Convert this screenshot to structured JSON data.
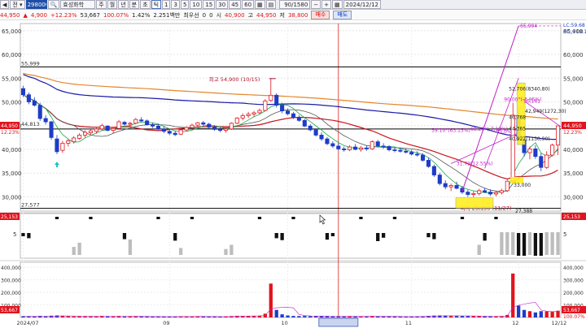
{
  "toolbar": {
    "code": "298000",
    "name": "효성화학",
    "tabs": [
      "주",
      "월",
      "년",
      "분",
      "초",
      "틱"
    ],
    "minutes": [
      "1",
      "3",
      "5",
      "10",
      "15",
      "30",
      "45",
      "60"
    ],
    "period": "90/1580",
    "date": "2024/12/12"
  },
  "info": {
    "price": "44,950",
    "change": "4,900",
    "change_pct": "+12.23%",
    "volume": "53,667",
    "vol_ratio": "100.07%",
    "turnover_ratio": "1.42%",
    "amount": "2.251백만",
    "mingyul": "최우선",
    "bid_qty": "0",
    "ask_qty": "0",
    "open_label": "시",
    "open": "40,900",
    "high_label": "고",
    "high": "44,950",
    "low_label": "저",
    "low": "38,800",
    "buy_label": "매수",
    "sell_label": "매도"
  },
  "axis": {
    "price_ticks": [
      "65,000",
      "60,000",
      "55,000",
      "50,000",
      "45,000",
      "40,000",
      "35,000",
      "30,000"
    ],
    "vol_ticks": [
      "400,000",
      "300,000",
      "200,000",
      "100,000"
    ],
    "osc_ticks": [
      "5"
    ],
    "x_labels": [
      "2024/07",
      "09",
      "10",
      "2024/10/21(월)",
      "11",
      "12",
      "12/12"
    ],
    "right_top_a": "LC:59.68",
    "right_top_b": "HC:+18.12",
    "price_tag": "44,950",
    "price_tag_pct": "12.23%",
    "osc_tag": "25,153",
    "vol_tag": "53,667",
    "vol_tag_pct": "100.07%"
  },
  "labels": {
    "hl_top": "55,999",
    "hl_bottom": "27,577",
    "left_level": "44,813",
    "left_tag": "25,153",
    "high_note": "최고 54,900 (10/15)",
    "low_note": "최저 28,150 (11/27)",
    "fib_top": "65,994",
    "fib_a": "52,706(8340,80)",
    "fib_b": "50,161",
    "fib_c": "90.00°(-3.95%)",
    "fib_d": "42,949(1272,30)",
    "fib_e": "46,768",
    "fib_f": "44,365",
    "fib_g": "40,922(1130,90)",
    "fib_h": "59.10°(63.15%)",
    "fib_i": "-68.20°(-7.19%)",
    "fib_j": "43.0%",
    "fib_k": "31.79(12.55%)",
    "fib_l": "33,000",
    "fib_m": "27,388"
  },
  "colors": {
    "up": "#e0141e",
    "down": "#1e3cc8",
    "ma_long": "#e3862b",
    "ma_mid": "#1a1aa8",
    "ma_red": "#c8141e",
    "fib": "#c31ec9",
    "hl": "#000000"
  },
  "chart_data": {
    "type": "candlestick",
    "y_range": [
      27000,
      66500
    ],
    "candles": [
      [
        52800,
        53400,
        51000,
        51500
      ],
      [
        51500,
        52000,
        49500,
        50000
      ],
      [
        50200,
        51000,
        49000,
        49300
      ],
      [
        49300,
        49800,
        46000,
        46500
      ],
      [
        46500,
        47200,
        45200,
        45800
      ],
      [
        45800,
        46000,
        42000,
        42500
      ],
      [
        42200,
        43000,
        39000,
        39500
      ],
      [
        39800,
        41800,
        39300,
        41300
      ],
      [
        41300,
        42200,
        40600,
        41800
      ],
      [
        41600,
        42800,
        41200,
        42400
      ],
      [
        42300,
        43400,
        42000,
        43000
      ],
      [
        43000,
        44000,
        42500,
        43600
      ],
      [
        43500,
        44200,
        43100,
        43900
      ],
      [
        43800,
        44600,
        43300,
        44300
      ],
      [
        44300,
        45400,
        44000,
        45000
      ],
      [
        44900,
        45100,
        43800,
        44000
      ],
      [
        44000,
        44600,
        43400,
        44400
      ],
      [
        44400,
        46200,
        44200,
        45800
      ],
      [
        45700,
        46000,
        45000,
        45300
      ],
      [
        45300,
        45800,
        44800,
        45500
      ],
      [
        45500,
        46600,
        45300,
        46300
      ],
      [
        46200,
        46800,
        45700,
        46000
      ],
      [
        46000,
        46300,
        45000,
        45200
      ],
      [
        45200,
        45600,
        44500,
        44900
      ],
      [
        44900,
        45300,
        44000,
        44300
      ],
      [
        44300,
        44800,
        43400,
        43800
      ],
      [
        43800,
        44200,
        43000,
        43400
      ],
      [
        43400,
        43900,
        42800,
        43100
      ],
      [
        43200,
        44400,
        43000,
        44100
      ],
      [
        44100,
        44900,
        43800,
        44600
      ],
      [
        44600,
        45400,
        44300,
        45100
      ],
      [
        45100,
        45800,
        44800,
        45600
      ],
      [
        45600,
        46000,
        45000,
        45300
      ],
      [
        45300,
        45600,
        44400,
        44700
      ],
      [
        44700,
        45100,
        43900,
        44200
      ],
      [
        44200,
        44700,
        43600,
        44000
      ],
      [
        44000,
        44600,
        43500,
        44300
      ],
      [
        44300,
        45700,
        44100,
        45500
      ],
      [
        45500,
        46800,
        45300,
        46600
      ],
      [
        46600,
        47600,
        46100,
        47100
      ],
      [
        47100,
        47900,
        46600,
        47400
      ],
      [
        47400,
        48100,
        46900,
        47700
      ],
      [
        47700,
        48600,
        47400,
        48200
      ],
      [
        48200,
        50600,
        48000,
        50200
      ],
      [
        50300,
        54900,
        50000,
        51400
      ],
      [
        51400,
        51800,
        48800,
        49300
      ],
      [
        49300,
        49800,
        47600,
        48100
      ],
      [
        48100,
        48600,
        47200,
        47500
      ],
      [
        47500,
        47900,
        46400,
        46700
      ],
      [
        46700,
        47200,
        45800,
        46100
      ],
      [
        46100,
        46400,
        44700,
        44900
      ],
      [
        44900,
        45300,
        43800,
        44100
      ],
      [
        44100,
        44400,
        42700,
        43000
      ],
      [
        43000,
        43600,
        41800,
        42200
      ],
      [
        42200,
        42600,
        40900,
        41200
      ],
      [
        41200,
        41700,
        40300,
        40700
      ],
      [
        40700,
        41300,
        39800,
        40100
      ],
      [
        40100,
        40600,
        39500,
        39900
      ],
      [
        39900,
        40900,
        39600,
        40500
      ],
      [
        40500,
        41100,
        39800,
        40000
      ],
      [
        40000,
        40700,
        39500,
        40300
      ],
      [
        40300,
        40800,
        39700,
        40100
      ],
      [
        40100,
        41900,
        39900,
        41600
      ],
      [
        41600,
        42000,
        40400,
        40700
      ],
      [
        40700,
        41300,
        40100,
        40600
      ],
      [
        40600,
        40900,
        39600,
        39900
      ],
      [
        39900,
        40400,
        39400,
        39800
      ],
      [
        39800,
        40300,
        39300,
        39600
      ],
      [
        39600,
        40100,
        39100,
        39400
      ],
      [
        39400,
        39900,
        38700,
        39000
      ],
      [
        39000,
        39600,
        38500,
        38800
      ],
      [
        38800,
        39200,
        37400,
        37700
      ],
      [
        37700,
        38200,
        36100,
        36400
      ],
      [
        36400,
        36800,
        34200,
        34600
      ],
      [
        34600,
        35100,
        32400,
        32800
      ],
      [
        32800,
        33500,
        31600,
        32100
      ],
      [
        32100,
        32800,
        31200,
        32400
      ],
      [
        32400,
        33200,
        31600,
        31800
      ],
      [
        31800,
        32300,
        30600,
        31000
      ],
      [
        31000,
        31500,
        30000,
        30500
      ],
      [
        30500,
        31200,
        29900,
        30700
      ],
      [
        30700,
        31700,
        30300,
        31300
      ],
      [
        31300,
        31900,
        30800,
        31000
      ],
      [
        31000,
        31600,
        30200,
        30600
      ],
      [
        30600,
        31300,
        30100,
        30900
      ],
      [
        30900,
        31700,
        30500,
        31300
      ],
      [
        31300,
        33600,
        31000,
        33300
      ],
      [
        33300,
        49800,
        32800,
        47200
      ],
      [
        47200,
        48600,
        41000,
        42000
      ],
      [
        42000,
        42800,
        38500,
        39300
      ],
      [
        39300,
        40600,
        37900,
        40100
      ],
      [
        40100,
        40900,
        38000,
        38500
      ],
      [
        38500,
        39200,
        35400,
        36200
      ],
      [
        36200,
        39600,
        35900,
        38800
      ],
      [
        38800,
        41200,
        38500,
        40900
      ],
      [
        40900,
        44950,
        38800,
        44950
      ]
    ],
    "volume_max": 440000,
    "volume": [
      10000,
      9000,
      8000,
      12000,
      9000,
      14000,
      16000,
      11000,
      9000,
      8000,
      9000,
      10000,
      9000,
      8000,
      12000,
      9000,
      8000,
      11000,
      8000,
      8000,
      10000,
      8000,
      7000,
      7000,
      7000,
      8000,
      7000,
      7000,
      9000,
      8000,
      8000,
      9000,
      7000,
      7000,
      7000,
      7000,
      8000,
      11000,
      13000,
      12000,
      11000,
      12000,
      14000,
      30000,
      270000,
      60000,
      25000,
      16000,
      12000,
      11000,
      12000,
      10000,
      11000,
      10000,
      10000,
      9000,
      9000,
      8000,
      10000,
      8000,
      8000,
      8000,
      12000,
      9000,
      8000,
      8000,
      7000,
      7000,
      7000,
      8000,
      8000,
      10000,
      12000,
      15000,
      16000,
      14000,
      12000,
      12000,
      12000,
      11000,
      10000,
      11000,
      9000,
      9000,
      9000,
      10000,
      20000,
      350000,
      95000,
      60000,
      50000,
      40000,
      50000,
      48000,
      45000,
      53667
    ],
    "marks": [
      0,
      0,
      0,
      0,
      0,
      0,
      0,
      0,
      0,
      0,
      0,
      0,
      0,
      0,
      0,
      0,
      0,
      0,
      0,
      0,
      0,
      0,
      0,
      0,
      0,
      0,
      0,
      0,
      0,
      0,
      0,
      0,
      0,
      0,
      0,
      0,
      0,
      0,
      0,
      0,
      0,
      0,
      0,
      0,
      0,
      0,
      0,
      0,
      0,
      0,
      0,
      0,
      0,
      0,
      0,
      0,
      0,
      0,
      0,
      0,
      0,
      0,
      0,
      0,
      0,
      0,
      0,
      0,
      0,
      0,
      0,
      0,
      0,
      0,
      0,
      0,
      0,
      0,
      0,
      0,
      0,
      0,
      0,
      0,
      0,
      0,
      0,
      0,
      0,
      0,
      0,
      0,
      0,
      0,
      0,
      0
    ]
  }
}
